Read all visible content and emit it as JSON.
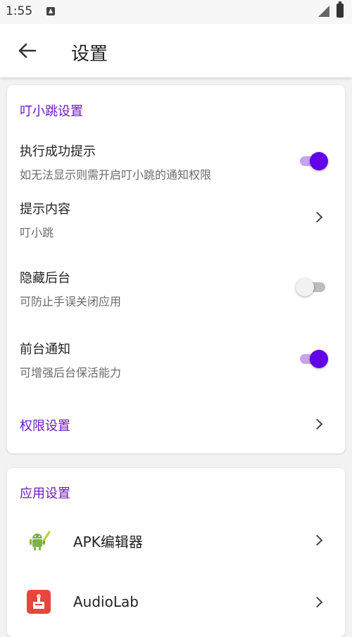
{
  "status_bar": {
    "time": "1:55"
  },
  "app_bar": {
    "title": "设置"
  },
  "section1": {
    "title": "叮小跳设置",
    "rows": [
      {
        "title": "执行成功提示",
        "subtitle": "如无法显示则需开启叮小跳的通知权限",
        "toggle": true
      },
      {
        "title": "提示内容",
        "subtitle": "叮小跳"
      },
      {
        "title": "隐藏后台",
        "subtitle": "可防止手误关闭应用",
        "toggle": false
      },
      {
        "title": "前台通知",
        "subtitle": "可增强后台保活能力",
        "toggle": true
      }
    ],
    "permission_link": "权限设置"
  },
  "section2": {
    "title": "应用设置",
    "apps": [
      {
        "name": "APK编辑器",
        "icon": "android-edit-icon"
      },
      {
        "name": "AudioLab",
        "icon": "audiolab-icon"
      }
    ]
  },
  "colors": {
    "accent": "#6200ea",
    "section_title": "#6a1bb8"
  }
}
